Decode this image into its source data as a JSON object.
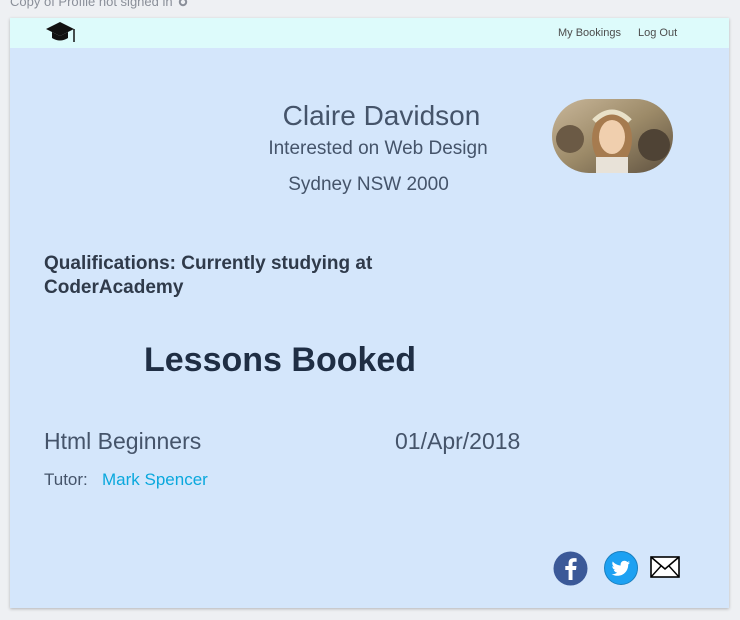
{
  "doc_title": "Copy of Profile not signed in",
  "nav": {
    "my_bookings": "My Bookings",
    "log_out": "Log Out"
  },
  "profile": {
    "name": "Claire Davidson",
    "interest": "Interested on Web Design",
    "location": "Sydney NSW 2000",
    "qualifications": "Qualifications:  Currently studying at CoderAcademy"
  },
  "lessons": {
    "heading": "Lessons Booked",
    "items": [
      {
        "name": "Html Beginners",
        "date": "01/Apr/2018",
        "tutor_label": "Tutor:",
        "tutor_name": "Mark Spencer"
      }
    ]
  },
  "social": [
    "facebook-icon",
    "twitter-icon",
    "mail-icon"
  ],
  "colors": {
    "page_bg": "#d4e6fb",
    "navbar_bg": "#ddfbfb",
    "link": "#0aa8dd",
    "facebook": "#3b5998",
    "twitter": "#1da1f2"
  }
}
